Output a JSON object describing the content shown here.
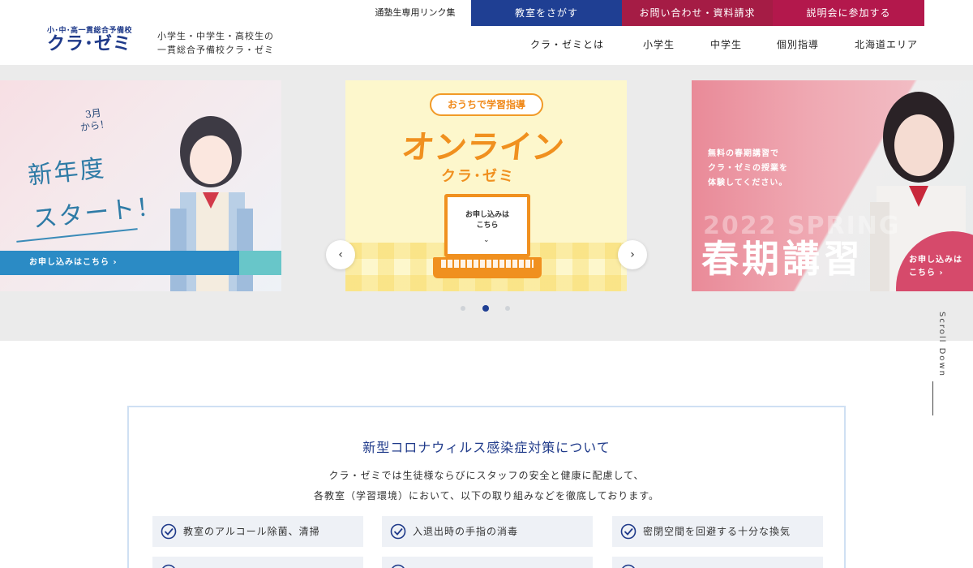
{
  "header": {
    "logo_sub": "小･中･高一貫総合予備校",
    "logo_main": "クラ･ゼミ",
    "tagline_line1": "小学生・中学生・高校生の",
    "tagline_line2": "一貫総合予備校クラ・ゼミ",
    "util_link": "通塾生専用リンク集",
    "buttons": {
      "find_school": "教室をさがす",
      "contact": "お問い合わせ・資料請求",
      "briefing": "説明会に参加する"
    },
    "nav": [
      "クラ・ゼミとは",
      "小学生",
      "中学生",
      "個別指導",
      "北海道エリア"
    ],
    "colors": {
      "blue": "#1f3f93",
      "red": "#a51c45",
      "crimson": "#b3184c"
    }
  },
  "hero": {
    "left": {
      "badge_line1": "3月",
      "badge_line2": "から！",
      "title_line1": "新年度",
      "title_line2": "スタート！",
      "cta": "お申し込みはこちら ›"
    },
    "center": {
      "pill": "おうちで学習指導",
      "big": "オンライン",
      "sub": "クラ･ゼミ",
      "screen_line1": "お申し込みは",
      "screen_line2": "こちら",
      "screen_chevron": "⌄"
    },
    "right": {
      "text_line1": "無料の春期講習で",
      "text_line2": "クラ・ゼミの授業を",
      "text_line3": "体験してください。",
      "watermark": "2022 SPRING",
      "big": "春期講習",
      "cta_line1": "お申し込みは",
      "cta_line2": "こちら ›"
    },
    "arrow_left": "‹",
    "arrow_right": "›",
    "dots_total": 3,
    "dots_active_index": 1,
    "scroll_label": "Scroll Down"
  },
  "covid": {
    "title": "新型コロナウィルス感染症対策について",
    "desc_line1": "クラ・ゼミでは生徒様ならびにスタッフの安全と健康に配慮して、",
    "desc_line2": "各教室（学習環境）において、以下の取り組みなどを徹底しております。",
    "items": [
      "教室のアルコール除菌、清掃",
      "入退出時の手指の消毒",
      "密閉空間を回避する十分な換気",
      "",
      "",
      ""
    ]
  }
}
